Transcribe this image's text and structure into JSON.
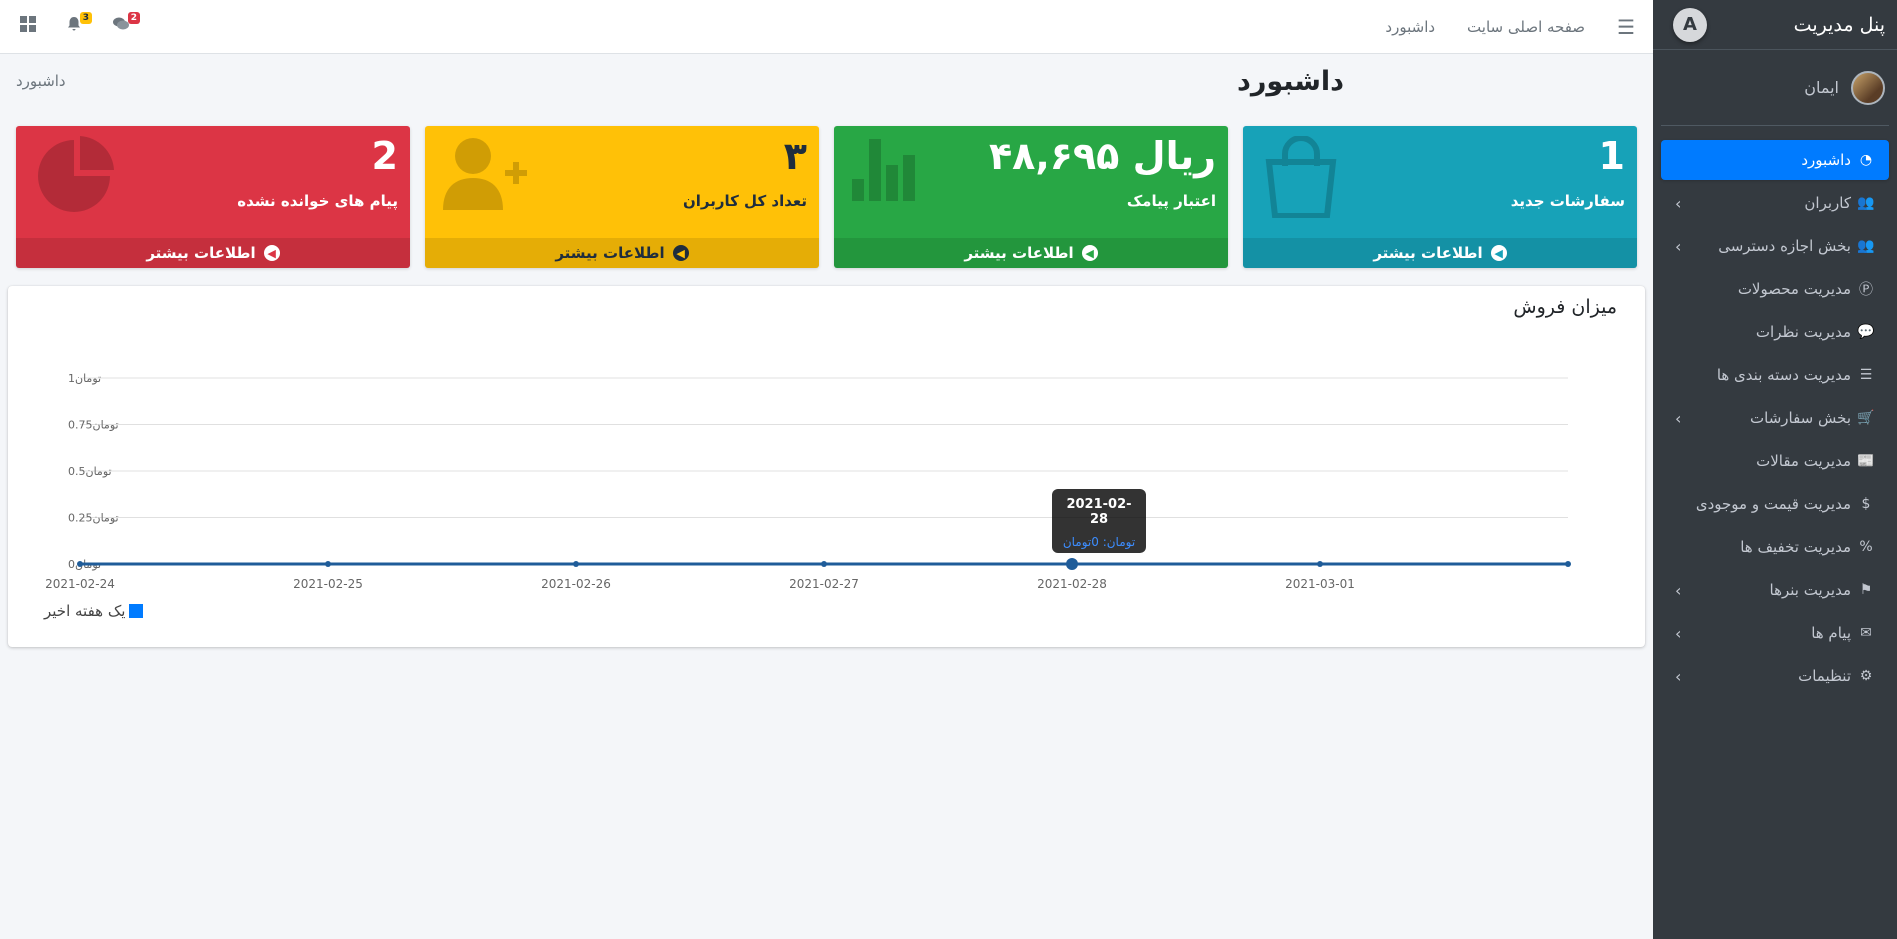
{
  "sidebar": {
    "brand_title": "پنل مدیریت",
    "brand_logo": "A",
    "user_name": "ایمان",
    "items": [
      {
        "label": "داشبورد",
        "icon": "dashboard-icon",
        "glyph": "◔",
        "has_children": false,
        "active": true
      },
      {
        "label": "کاربران",
        "icon": "users-icon",
        "glyph": "👥",
        "has_children": true
      },
      {
        "label": "بخش اجازه دسترسی",
        "icon": "users-icon",
        "glyph": "👥",
        "has_children": true
      },
      {
        "label": "مدیریت محصولات",
        "icon": "product-icon",
        "glyph": "Ⓟ",
        "has_children": false
      },
      {
        "label": "مدیریت نظرات",
        "icon": "comments-icon",
        "glyph": "💬",
        "has_children": false
      },
      {
        "label": "مدیریت دسته بندی ها",
        "icon": "list-icon",
        "glyph": "☰",
        "has_children": false
      },
      {
        "label": "بخش سفارشات",
        "icon": "cart-icon",
        "glyph": "🛒",
        "has_children": true
      },
      {
        "label": "مدیریت مقالات",
        "icon": "newspaper-icon",
        "glyph": "📰",
        "has_children": false
      },
      {
        "label": "مدیریت قیمت و موجودی",
        "icon": "dollar-icon",
        "glyph": "$",
        "has_children": false
      },
      {
        "label": "مدیریت تخفیف ها",
        "icon": "percent-icon",
        "glyph": "%",
        "has_children": false
      },
      {
        "label": "مدیریت بنرها",
        "icon": "flag-icon",
        "glyph": "⚑",
        "has_children": true
      },
      {
        "label": "پیام ها",
        "icon": "envelope-icon",
        "glyph": "✉",
        "has_children": true
      },
      {
        "label": "تنظیمات",
        "icon": "user-cog-icon",
        "glyph": "⚙",
        "has_children": true
      }
    ]
  },
  "topbar": {
    "home_link": "صفحه اصلی سایت",
    "dashboard_link": "داشبورد",
    "notifications_count": "3",
    "messages_count": "2"
  },
  "header": {
    "title": "داشبورد",
    "breadcrumb": "داشبورد"
  },
  "boxes": [
    {
      "number": "1",
      "label": "سفارشات جدید",
      "more": "اطلاعات بیشتر",
      "color": "#17a2b8",
      "icon": "shopping-bag-icon"
    },
    {
      "number": "۴۸,۶۹۵ ریال",
      "label": "اعتبار پیامک",
      "more": "اطلاعات بیشتر",
      "color": "#28a745",
      "icon": "bar-chart-icon"
    },
    {
      "number": "۳",
      "label": "تعداد کل کاربران",
      "more": "اطلاعات بیشتر",
      "color": "#ffc107",
      "icon": "user-plus-icon"
    },
    {
      "number": "2",
      "label": "پیام های خوانده نشده",
      "more": "اطلاعات بیشتر",
      "color": "#dc3545",
      "icon": "pie-chart-icon"
    }
  ],
  "sales_card": {
    "title": "میزان فروش"
  },
  "chart_data": {
    "type": "line",
    "x": [
      "2021-02-24",
      "2021-02-25",
      "2021-02-26",
      "2021-02-27",
      "2021-02-28",
      "2021-03-01",
      ""
    ],
    "series": [
      {
        "name": "یک هفته اخیر",
        "values": [
          0,
          0,
          0,
          0,
          0,
          0,
          0
        ],
        "color": "#1f5c99"
      }
    ],
    "y_ticks": [
      "0تومان",
      "0.25تومان",
      "0.5تومان",
      "0.75تومان",
      "1تومان"
    ],
    "ylim": [
      0,
      1
    ],
    "grid": true,
    "legend": "bottom-left",
    "tooltip": {
      "title": "2021-02-28",
      "body": "تومان: 0تومان",
      "index": 4
    }
  }
}
